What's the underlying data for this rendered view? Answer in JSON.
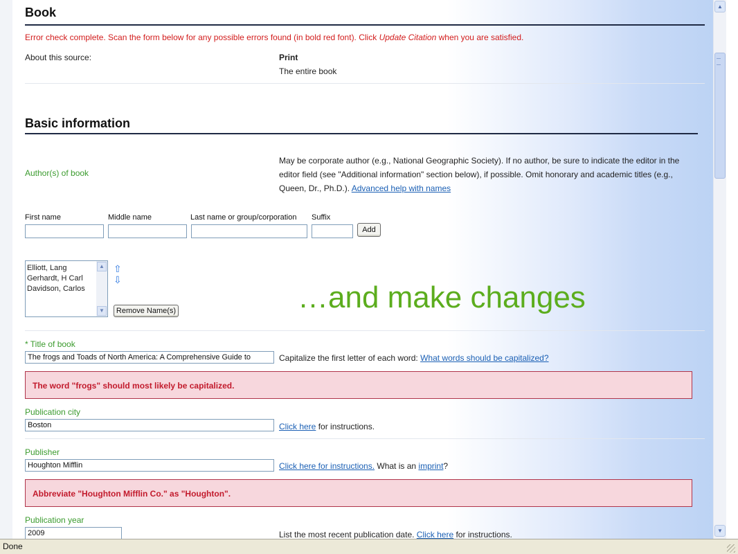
{
  "page": {
    "heading": "Book",
    "error_prefix": "Error check complete. Scan the form below for any possible errors found (in bold red font). Click ",
    "error_link": "Update Citation",
    "error_suffix": " when you are satisfied."
  },
  "about": {
    "label": "About this source:",
    "medium": "Print",
    "scope": "The entire book"
  },
  "basic": {
    "heading": "Basic information",
    "author_label": "Author(s) of book",
    "author_help": "May be corporate author (e.g., National Geographic Society). If no author, be sure to indicate the editor in the editor field (see \"Additional information\" section below), if possible. Omit honorary and academic titles (e.g., Queen, Dr., Ph.D.). ",
    "author_help_link": "Advanced help with names"
  },
  "name_fields": {
    "first": "First name",
    "middle": "Middle name",
    "last": "Last name or group/corporation",
    "suffix": "Suffix",
    "add_button": "Add"
  },
  "names_list": {
    "items": [
      "Elliott, Lang",
      "Gerhardt, H Carl",
      "Davidson, Carlos"
    ],
    "remove_button": "Remove Name(s)"
  },
  "overlay_text": "…and make changes",
  "title": {
    "required_mark": "*",
    "label": " Title of book",
    "value": "The frogs and Toads of North America: A Comprehensive Guide to",
    "note": "Capitalize the first letter of each word: ",
    "note_link": "What words should be capitalized?",
    "error": "The word \"frogs\" should most likely be capitalized."
  },
  "city": {
    "label": "Publication city",
    "value": "Boston",
    "link": "Click here",
    "suffix": " for instructions."
  },
  "publisher": {
    "label": "Publisher",
    "value": "Houghton Mifflin",
    "link": "Click here for instructions.",
    "mid": " What is an ",
    "link2": "imprint",
    "end": "?",
    "error": "Abbreviate \"Houghton Mifflin Co.\" as \"Houghton\"."
  },
  "year": {
    "label": "Publication year",
    "value": "2009",
    "prefix": "List the most recent publication date. ",
    "link": "Click here",
    "suffix": " for instructions."
  },
  "status": {
    "text": "Done"
  },
  "colors": {
    "error_red": "#d21c1c",
    "label_green": "#3b9b2e",
    "overlay_green": "#5cad1e",
    "link_blue": "#1a5fb4",
    "error_box_bg": "#f7d7dd"
  },
  "icons": [
    "arrow-up-icon",
    "arrow-down-icon",
    "scroll-up-icon",
    "scroll-down-icon",
    "resize-grip-icon"
  ]
}
